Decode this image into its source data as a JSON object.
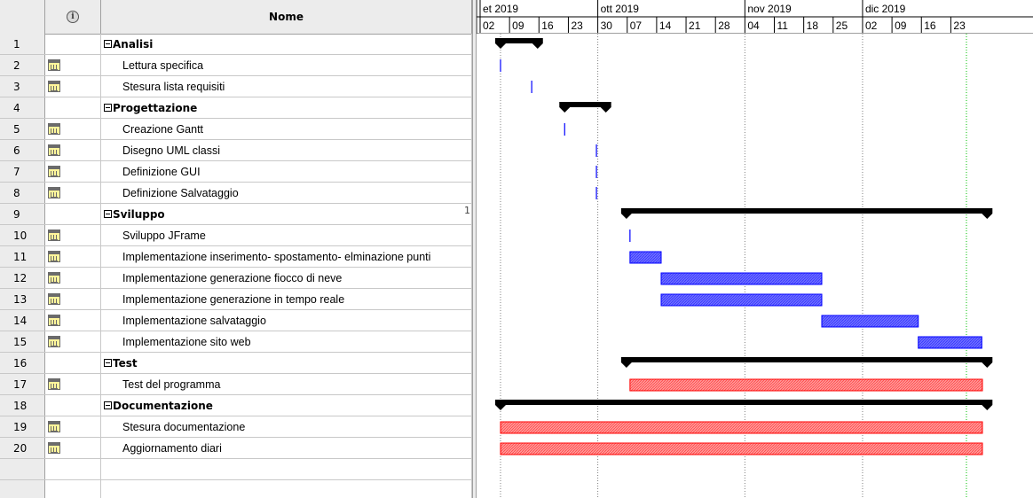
{
  "header": {
    "info_icon": "info-icon",
    "name_label": "Nome"
  },
  "tasks": [
    {
      "id": "1",
      "name": "Analisi",
      "summary": true,
      "icon": ""
    },
    {
      "id": "2",
      "name": "Lettura specifica",
      "summary": false,
      "icon": "calendar-icon"
    },
    {
      "id": "3",
      "name": "Stesura lista requisiti",
      "summary": false,
      "icon": "calendar-icon"
    },
    {
      "id": "4",
      "name": "Progettazione",
      "summary": true,
      "icon": ""
    },
    {
      "id": "5",
      "name": "Creazione Gantt",
      "summary": false,
      "icon": "calendar-icon"
    },
    {
      "id": "6",
      "name": "Disegno UML classi",
      "summary": false,
      "icon": "calendar-icon"
    },
    {
      "id": "7",
      "name": "Definizione GUI",
      "summary": false,
      "icon": "calendar-icon"
    },
    {
      "id": "8",
      "name": "Definizione Salvataggio",
      "summary": false,
      "icon": "calendar-icon"
    },
    {
      "id": "9",
      "name": "Sviluppo",
      "summary": true,
      "icon": ""
    },
    {
      "id": "10",
      "name": "Sviluppo JFrame",
      "summary": false,
      "icon": "calendar-icon"
    },
    {
      "id": "11",
      "name": "Implementazione inserimento- spostamento- elminazione punti",
      "summary": false,
      "icon": "calendar-icon"
    },
    {
      "id": "12",
      "name": "Implementazione generazione fiocco di neve",
      "summary": false,
      "icon": "calendar-icon"
    },
    {
      "id": "13",
      "name": "Implementazione generazione in tempo reale",
      "summary": false,
      "icon": "calendar-icon"
    },
    {
      "id": "14",
      "name": "Implementazione salvataggio",
      "summary": false,
      "icon": "calendar-icon"
    },
    {
      "id": "15",
      "name": "Implementazione sito web",
      "summary": false,
      "icon": "calendar-icon"
    },
    {
      "id": "16",
      "name": "Test",
      "summary": true,
      "icon": ""
    },
    {
      "id": "17",
      "name": "Test del programma",
      "summary": false,
      "icon": "calendar-icon"
    },
    {
      "id": "18",
      "name": "Documentazione",
      "summary": true,
      "icon": ""
    },
    {
      "id": "19",
      "name": "Stesura documentazione",
      "summary": false,
      "icon": "calendar-icon"
    },
    {
      "id": "20",
      "name": "Aggiornamento diari",
      "summary": false,
      "icon": "calendar-icon"
    }
  ],
  "split_marker": "1",
  "timeline": {
    "months": [
      "et 2019",
      "ott 2019",
      "nov 2019",
      "dic 2019"
    ],
    "weeks": [
      "02",
      "09",
      "16",
      "23",
      "30",
      "07",
      "14",
      "21",
      "28",
      "04",
      "11",
      "18",
      "25",
      "02",
      "09",
      "16",
      "23"
    ]
  },
  "gantt_bars": [
    {
      "row": 1,
      "kind": "summary",
      "start_week": 0.0,
      "end_week": 0.63
    },
    {
      "row": 2,
      "kind": "milestone",
      "start_week": 0.0
    },
    {
      "row": 3,
      "kind": "milestone",
      "start_week": 0.53
    },
    {
      "row": 4,
      "kind": "summary",
      "start_week": 1.09,
      "end_week": 1.79
    },
    {
      "row": 5,
      "kind": "milestone",
      "start_week": 1.09
    },
    {
      "row": 6,
      "kind": "milestone",
      "start_week": 1.63
    },
    {
      "row": 7,
      "kind": "milestone",
      "start_week": 1.63
    },
    {
      "row": 8,
      "kind": "milestone",
      "start_week": 1.63
    },
    {
      "row": 9,
      "kind": "summary",
      "start_week": 2.14,
      "end_week": 8.27
    },
    {
      "row": 10,
      "kind": "milestone",
      "start_week": 2.2
    },
    {
      "row": 11,
      "kind": "task",
      "color": "blue",
      "start_week": 2.2,
      "end_week": 2.73
    },
    {
      "row": 12,
      "kind": "task",
      "color": "blue",
      "start_week": 2.73,
      "end_week": 5.46
    },
    {
      "row": 13,
      "kind": "task",
      "color": "blue",
      "start_week": 2.73,
      "end_week": 5.46
    },
    {
      "row": 14,
      "kind": "task",
      "color": "blue",
      "start_week": 5.46,
      "end_week": 7.1
    },
    {
      "row": 15,
      "kind": "task",
      "color": "blue",
      "start_week": 7.1,
      "end_week": 8.18
    },
    {
      "row": 16,
      "kind": "summary",
      "start_week": 2.14,
      "end_week": 8.27
    },
    {
      "row": 17,
      "kind": "task",
      "color": "red",
      "start_week": 2.2,
      "end_week": 8.19
    },
    {
      "row": 18,
      "kind": "summary",
      "start_week": 0.0,
      "end_week": 8.27
    },
    {
      "row": 19,
      "kind": "task",
      "color": "red",
      "start_week": 0.0,
      "end_week": 8.19
    },
    {
      "row": 20,
      "kind": "task",
      "color": "red",
      "start_week": 0.0,
      "end_week": 8.19
    }
  ],
  "today_week": 7.71,
  "colors": {
    "task_blue": "#0000ff",
    "task_blue_fill": "#6f6fff",
    "task_red": "#ff0000",
    "task_red_fill": "#ff9999",
    "summary": "#000000",
    "grid": "#a0a0a0",
    "today": "#00c000"
  }
}
